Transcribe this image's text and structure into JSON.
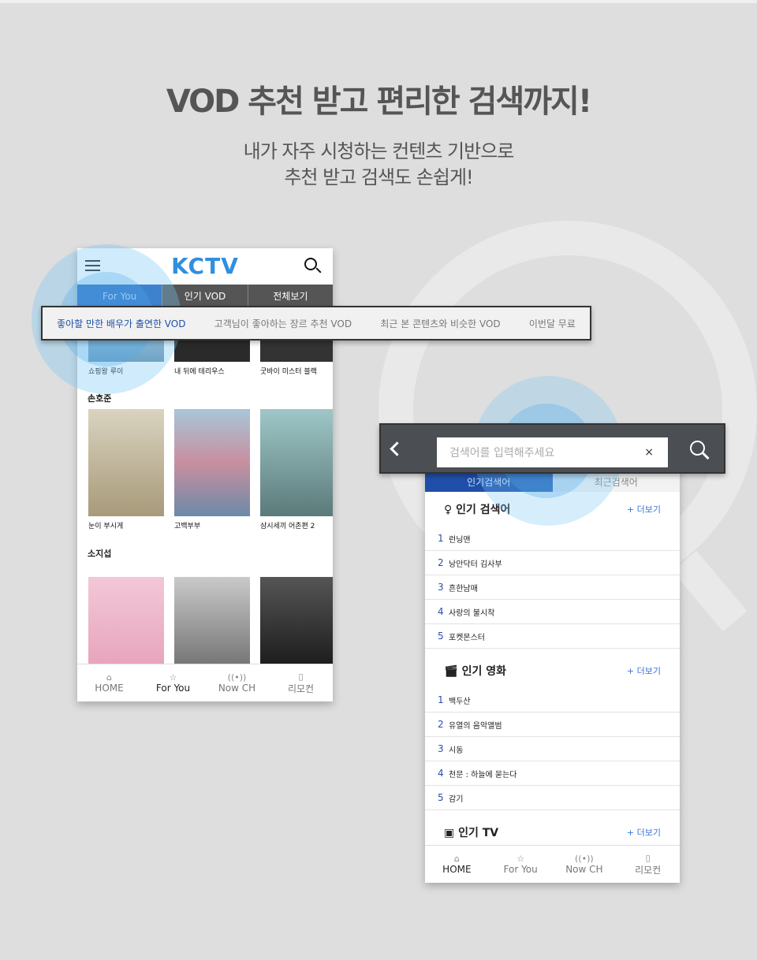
{
  "headline": "VOD 추천 받고 편리한 검색까지!",
  "subline1": "내가 자주 시청하는 컨텐츠 기반으로",
  "subline2": "추천 받고 검색도 손쉽게!",
  "colors": {
    "accent": "#1f5cb8",
    "logo": "#2f8fe0",
    "background": "#dedede"
  },
  "left_phone": {
    "logo": "KCTV",
    "tabs": [
      "For You",
      "인기 VOD",
      "전체보기"
    ],
    "recommend_tabs": [
      "좋아할 만한 배우가 출연한 VOD",
      "고객님이 좋아하는 장르 추천 VOD",
      "최근 본 콘텐츠와 비슷한 VOD",
      "이번달 무료"
    ],
    "row1": [
      "쇼핑왕 루이",
      "내 뒤에 테리우스",
      "굿바이 미스터 블랙"
    ],
    "section2": "손호준",
    "row2": [
      "눈이 부시게",
      "고백부부",
      "삼시세끼 어촌편 2"
    ],
    "section3": "소지섭",
    "nav": [
      "HOME",
      "For You",
      "Now CH",
      "리모컨"
    ]
  },
  "right_phone": {
    "search_placeholder": "검색어를 입력해주세요",
    "clear": "×",
    "tabs": [
      "인기검색어",
      "최근검색어"
    ],
    "more": "+ 더보기",
    "sections": [
      {
        "title": "인기 검색어",
        "icon": "trophy-icon",
        "items": [
          "런닝맨",
          "낭만닥터 김사부",
          "흔한남매",
          "사랑의 불시착",
          "포켓몬스터"
        ]
      },
      {
        "title": "인기 영화",
        "icon": "clapper-icon",
        "items": [
          "백두산",
          "유열의 음악앨범",
          "시동",
          "천문 : 하늘에 묻는다",
          "감기"
        ]
      },
      {
        "title": "인기 TV",
        "icon": "tv-icon",
        "items": []
      }
    ],
    "nav": [
      "HOME",
      "For You",
      "Now CH",
      "리모컨"
    ]
  }
}
